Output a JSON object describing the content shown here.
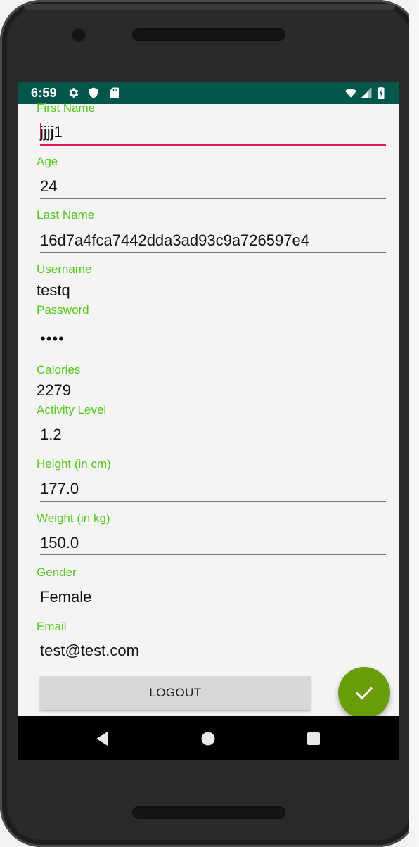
{
  "status_bar": {
    "time": "6:59",
    "icons": [
      "settings-icon",
      "shield-icon",
      "sd-card-icon",
      "wifi-icon",
      "signal-icon",
      "battery-charging-icon"
    ],
    "background": "#03574a"
  },
  "form": {
    "first_name": {
      "label": "First Name",
      "value": "jjjj1"
    },
    "age": {
      "label": "Age",
      "value": "24"
    },
    "last_name": {
      "label": "Last Name",
      "value": "16d7a4fca7442dda3ad93c9a726597e4"
    },
    "username": {
      "label": "Username",
      "value": "testq"
    },
    "password": {
      "label": "Password",
      "value": "••••"
    },
    "calories": {
      "label": "Calories",
      "value": "2279"
    },
    "activity_level": {
      "label": "Activity Level",
      "value": "1.2"
    },
    "height": {
      "label": "Height (in cm)",
      "value": "177.0"
    },
    "weight": {
      "label": "Weight (in kg)",
      "value": "150.0"
    },
    "gender": {
      "label": "Gender",
      "value": "Female"
    },
    "email": {
      "label": "Email",
      "value": "test@test.com"
    }
  },
  "buttons": {
    "logout_label": "LOGOUT",
    "fab_icon": "check-icon"
  },
  "nav_bar": {
    "icons": [
      "back-icon",
      "home-icon",
      "recents-icon"
    ]
  },
  "colors": {
    "label": "#54c81c",
    "focus_underline": "#e21a61",
    "fab": "#689c08"
  }
}
